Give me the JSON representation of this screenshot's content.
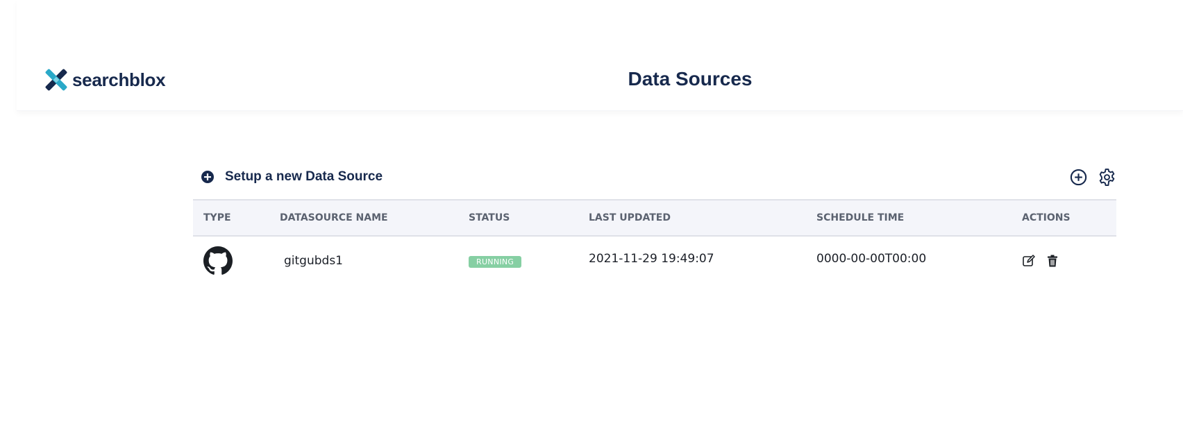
{
  "header": {
    "brand": "searchblox",
    "title": "Data Sources"
  },
  "toolbar": {
    "setup_label": "Setup a new Data Source",
    "add_icon": "plus-circle-icon",
    "settings_icon": "gear-icon"
  },
  "table": {
    "columns": [
      "TYPE",
      "DATASOURCE NAME",
      "STATUS",
      "LAST UPDATED",
      "SCHEDULE TIME",
      "ACTIONS"
    ],
    "rows": [
      {
        "type_icon": "github-icon",
        "name": "gitgubds1",
        "status": "RUNNING",
        "last_updated": "2021-11-29 19:49:07",
        "schedule_time": "0000-00-00T00:00",
        "actions": [
          "edit-icon",
          "trash-icon"
        ]
      }
    ]
  },
  "colors": {
    "brand_navy": "#17294d",
    "brand_teal": "#2aa9c8",
    "status_running": "#86cfa3"
  }
}
